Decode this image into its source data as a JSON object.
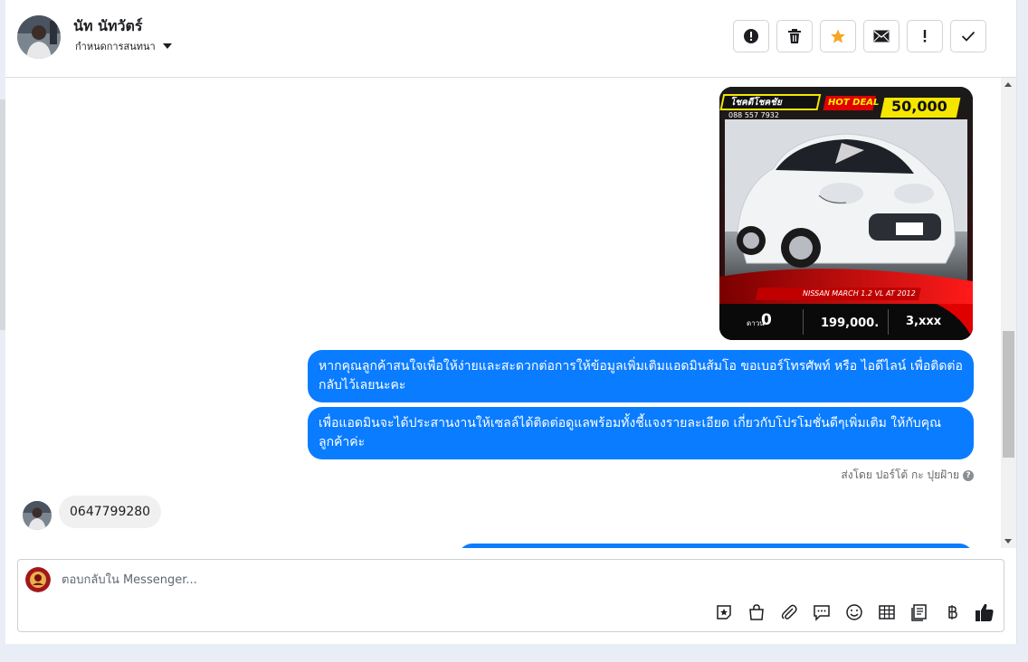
{
  "header": {
    "contact_name": "นัท นัทวัตร์",
    "assign_label": "กำหนดการสนทนา",
    "buttons": [
      {
        "name": "spam-button",
        "icon": "alert-circle-icon"
      },
      {
        "name": "delete-button",
        "icon": "trash-icon"
      },
      {
        "name": "star-button",
        "icon": "star-icon"
      },
      {
        "name": "mark-unread-button",
        "icon": "envelope-icon"
      },
      {
        "name": "follow-up-button",
        "icon": "exclamation-icon"
      },
      {
        "name": "mark-done-button",
        "icon": "check-icon"
      }
    ],
    "star_color": "#f5a623"
  },
  "messages": {
    "car_ad": {
      "brand_text": "โชคดีโชคชัย",
      "deal_label": "HOT DEAL",
      "price_banner": "50,000",
      "phone": "088 557 7932",
      "model": "NISSAN MARCH 1.2 VL AT 2012",
      "down_label": "ดาวน์",
      "down_value": "0",
      "price_value": "199,000.",
      "installment_value": "3,xxx"
    },
    "outgoing_1": "หากคุณลูกค้าสนใจเพื่อให้ง่ายและสะดวกต่อการให้ข้อมูลเพิ่มเติมแอดมินส้มโอ ขอเบอร์โทรศัพท์ หรือ ไอดีไลน์ เพื่อติดต่อกลับไว้เลยนะคะ",
    "outgoing_2": "เพื่อแอดมินจะได้ประสานงานให้เซลล์ได้ติดต่อดูแลพร้อมทั้งชี้แจงรายละเอียด เกี่ยวกับโปรโมชั่นดีๆเพิ่มเติม ให้กับคุณลูกค้าค่ะ",
    "sent_by": "ส่งโดย ปอร์โต้ กะ ปุยฝ้าย",
    "incoming_1": "0647799280"
  },
  "composer": {
    "placeholder": "ตอบกลับใน Messenger...",
    "icons": [
      "sticker-star-icon",
      "bag-icon",
      "paperclip-icon",
      "chat-bubble-icon",
      "smiley-icon",
      "table-icon",
      "saved-reply-icon",
      "baht-icon",
      "thumbs-up-icon"
    ]
  },
  "colors": {
    "bubble_out": "#0a7cff",
    "bubble_in": "#f0f0f0"
  }
}
